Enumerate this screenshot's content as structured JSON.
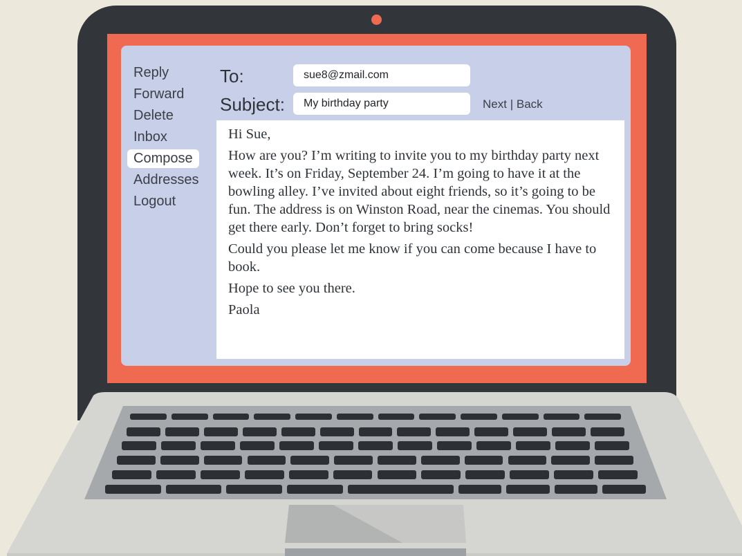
{
  "sidebar": {
    "items": [
      {
        "label": "Reply"
      },
      {
        "label": "Forward"
      },
      {
        "label": "Delete"
      },
      {
        "label": "Inbox"
      },
      {
        "label": "Compose",
        "active": true
      },
      {
        "label": "Addresses"
      },
      {
        "label": "Logout"
      }
    ]
  },
  "header": {
    "to_label": "To:",
    "to_value": "sue8@zmail.com",
    "subject_label": "Subject:",
    "subject_value": "My birthday party",
    "next_label": "Next",
    "separator": "|",
    "back_label": "Back"
  },
  "message": {
    "paragraphs": [
      "Hi Sue,",
      "How are you? I’m writing to invite you to my birthday party next week. It’s on Friday, September 24. I’m going to have it at the bowling alley. I’ve invited about eight friends, so it’s going to be fun. The address is on Winston Road, near the cinemas. You should get there early. Don’t forget to bring socks!",
      "Could you please let me know if you can come because I have to book.",
      "Hope to see you there.",
      "Paola"
    ]
  },
  "colors": {
    "bezel_accent": "#f06a52",
    "screen_background": "#c8cfe8",
    "laptop_body": "#32363a",
    "page_background": "#ece8dc"
  }
}
